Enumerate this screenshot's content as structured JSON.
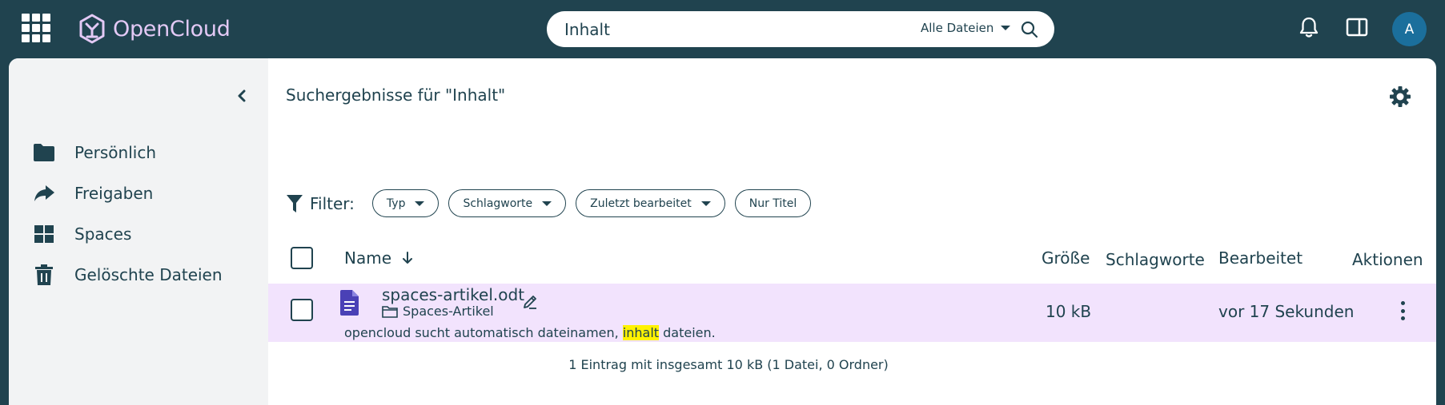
{
  "topbar": {
    "brand": "OpenCloud",
    "search": {
      "value": "Inhalt",
      "scope": "Alle Dateien"
    },
    "avatar_initial": "A",
    "icons": [
      "apps-grid-icon",
      "opencloud-logo-icon",
      "search-icon",
      "bell-icon",
      "sidebar-panel-icon"
    ]
  },
  "sidebar": {
    "items": [
      {
        "label": "Persönlich",
        "icon": "folder-icon"
      },
      {
        "label": "Freigaben",
        "icon": "share-icon"
      },
      {
        "label": "Spaces",
        "icon": "grid-icon"
      },
      {
        "label": "Gelöschte Dateien",
        "icon": "trash-icon"
      }
    ]
  },
  "main": {
    "results_title": "Suchergebnisse für \"Inhalt\"",
    "filter": {
      "label": "Filter:",
      "chips": [
        "Typ",
        "Schlagworte",
        "Zuletzt bearbeitet",
        "Nur Titel"
      ]
    },
    "table": {
      "columns": {
        "name": "Name",
        "size": "Größe",
        "tags": "Schlagworte",
        "modified": "Bearbeitet",
        "actions": "Aktionen"
      },
      "rows": [
        {
          "name": "spaces-artikel.odt",
          "location": "Spaces-Artikel",
          "snippet_before": "opencloud sucht automatisch dateinamen, ",
          "snippet_highlight": "inhalt",
          "snippet_after": " dateien.",
          "size": "10 kB",
          "modified": "vor 17 Sekunden"
        }
      ]
    },
    "summary": "1 Eintrag mit insgesamt 10 kB (1 Datei, 0 Ordner)"
  },
  "colors": {
    "header_bg": "#20434f",
    "brand_accent": "#e3c9f5",
    "row_highlight": "#f2e3fd",
    "search_highlight": "#fff200",
    "avatar_bg": "#1b6f9c"
  }
}
